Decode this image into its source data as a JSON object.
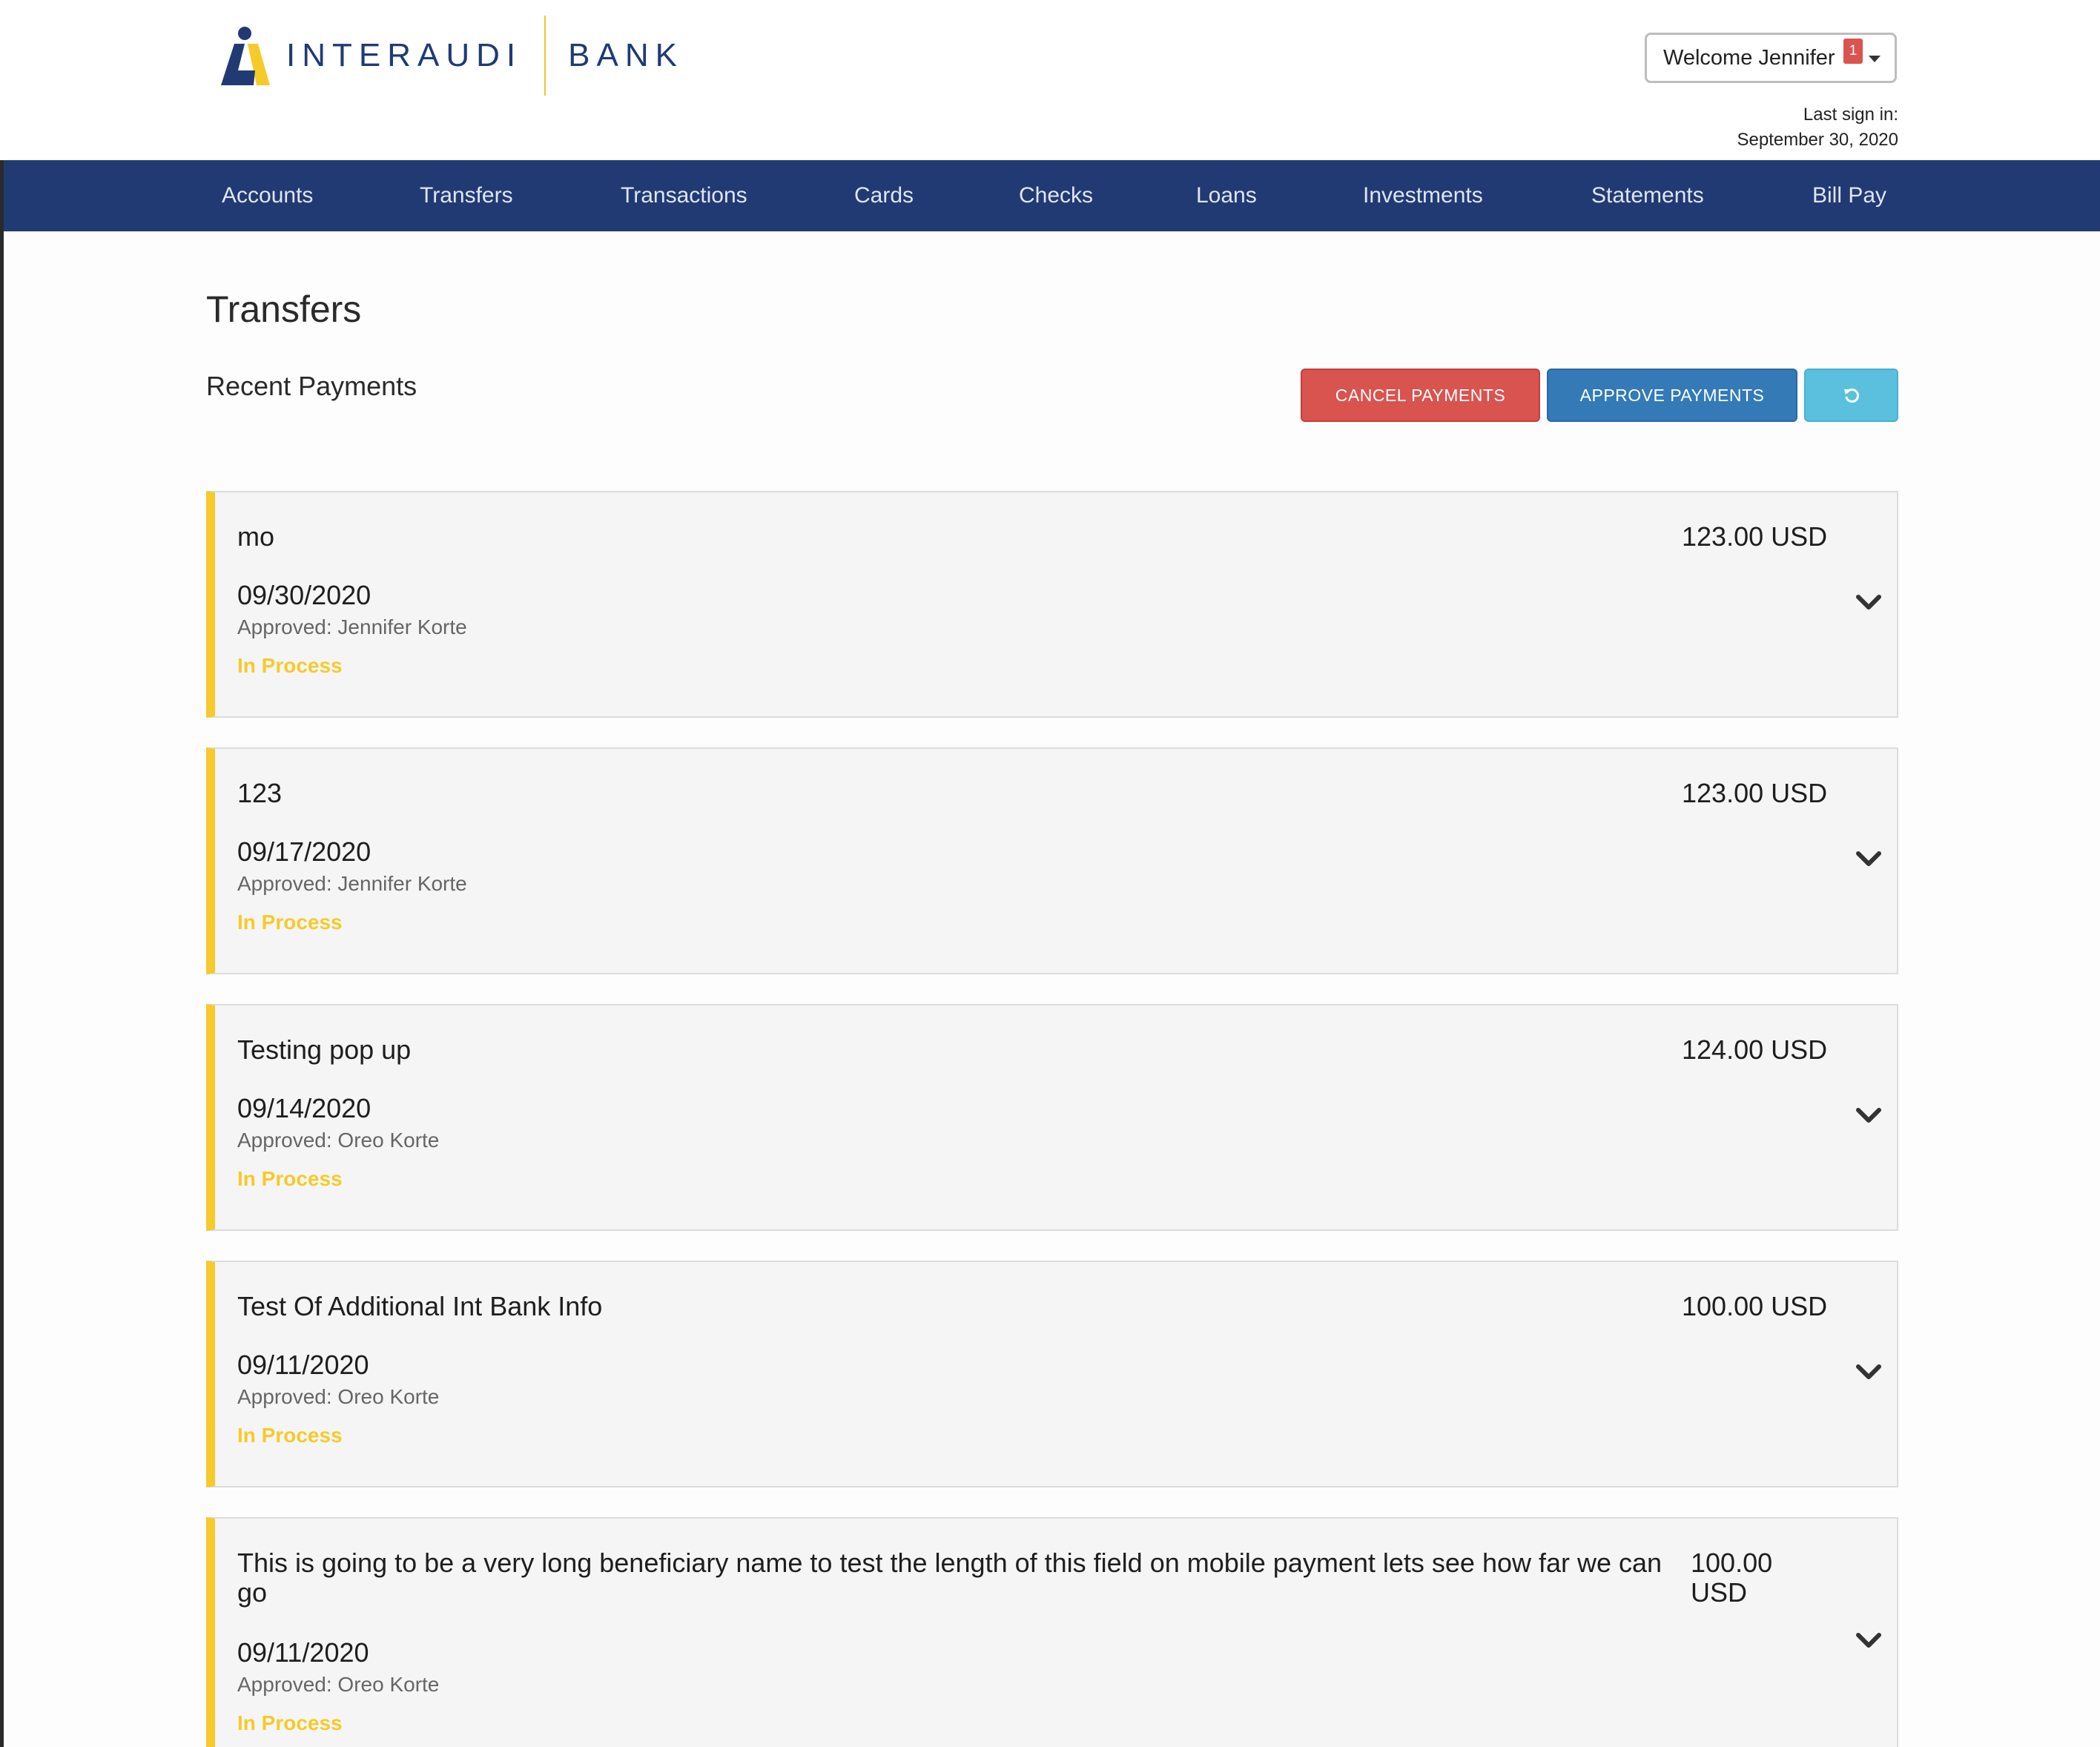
{
  "brand": {
    "name_part1": "INTERAUDI",
    "name_part2": "BANK",
    "accent_yellow": "#f7ca2b",
    "navy": "#213a73"
  },
  "user_menu": {
    "welcome_text": "Welcome Jennifer",
    "notification_count": "1",
    "last_sign_in_label": "Last sign in:",
    "last_sign_in_date": "September 30, 2020"
  },
  "nav": {
    "items": [
      "Accounts",
      "Transfers",
      "Transactions",
      "Cards",
      "Checks",
      "Loans",
      "Investments",
      "Statements",
      "Bill Pay"
    ]
  },
  "page": {
    "title": "Transfers",
    "section_title": "Recent Payments"
  },
  "actions": {
    "cancel_label": "CANCEL PAYMENTS",
    "approve_label": "APPROVE PAYMENTS",
    "refresh_icon": "refresh-icon"
  },
  "payments": [
    {
      "name": "mo",
      "amount": "123.00 USD",
      "date": "09/30/2020",
      "approved": "Approved: Jennifer Korte",
      "status": "In Process"
    },
    {
      "name": "123",
      "amount": "123.00 USD",
      "date": "09/17/2020",
      "approved": "Approved: Jennifer Korte",
      "status": "In Process"
    },
    {
      "name": "Testing pop up",
      "amount": "124.00 USD",
      "date": "09/14/2020",
      "approved": "Approved: Oreo Korte",
      "status": "In Process"
    },
    {
      "name": "Test Of Additional Int Bank Info",
      "amount": "100.00 USD",
      "date": "09/11/2020",
      "approved": "Approved: Oreo Korte",
      "status": "In Process"
    },
    {
      "name": "This is going to be a very long beneficiary name to test the length of this field on mobile payment lets see how far we can go",
      "amount": "100.00 USD",
      "date": "09/11/2020",
      "approved": "Approved: Oreo Korte",
      "status": "In Process"
    }
  ]
}
